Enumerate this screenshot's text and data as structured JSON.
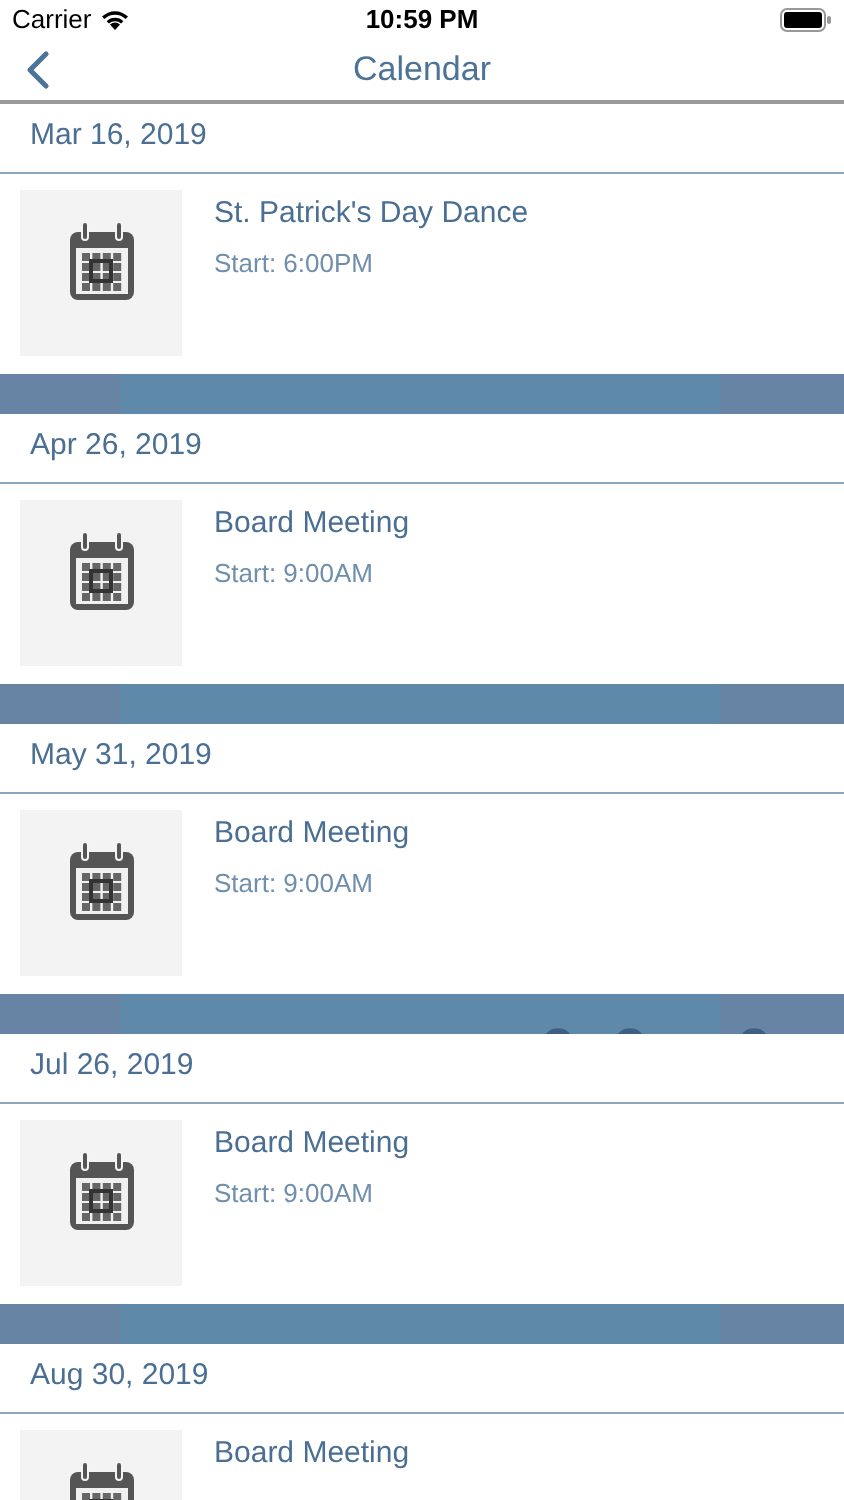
{
  "status_bar": {
    "carrier": "Carrier",
    "time": "10:59 PM"
  },
  "nav": {
    "title": "Calendar"
  },
  "events": [
    {
      "date": "Mar 16, 2019",
      "title": "St. Patrick's Day Dance",
      "start": "Start: 6:00PM"
    },
    {
      "date": "Apr 26, 2019",
      "title": "Board Meeting",
      "start": "Start: 9:00AM"
    },
    {
      "date": "May 31, 2019",
      "title": "Board Meeting",
      "start": "Start: 9:00AM"
    },
    {
      "date": "Jul 26, 2019",
      "title": "Board Meeting",
      "start": "Start: 9:00AM"
    },
    {
      "date": "Aug 30, 2019",
      "title": "Board Meeting"
    }
  ]
}
